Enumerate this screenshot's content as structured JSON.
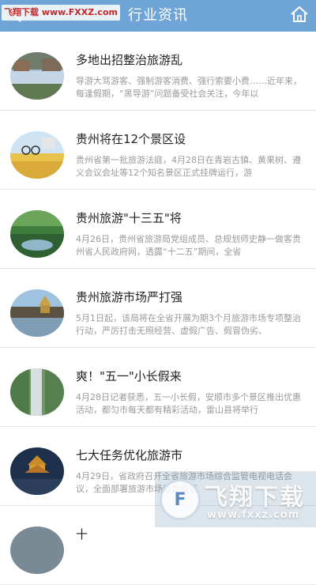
{
  "header": {
    "title": "行业资讯",
    "back_icon": "chevron-left-icon",
    "home_icon": "home-icon",
    "background": "#6fa4d6"
  },
  "watermark": {
    "top_left": "飞翔下载 www.FXXZ.com",
    "brand": "飞翔下载",
    "url": "www.fxxz.com"
  },
  "news": [
    {
      "title": "多地出招整治旅游乱",
      "summary": "导游大骂游客、强制游客消费、强行索要小费……近年来，每逢假期，“黑导游”问题备受社会关注，今年以"
    },
    {
      "title": "贵州将在12个景区设",
      "summary": "贵州省第一批旅游法庭，4月28日在青岩古镇、黄果树、遵义会议会址等12个知名景区正式挂牌运行，游"
    },
    {
      "title": "贵州旅游\"十三五\"将",
      "summary": "4月26日，贵州省旅游局党组成员、总规划师史静一做客贵州省人民政府网，透露“十二五”期间，全省"
    },
    {
      "title": "贵州旅游市场严打强",
      "summary": "5月1日起，该局将在全省开展为期3个月旅游市场专项整治行动，严厉打击无照经营、虚假广告、假冒伪劣、"
    },
    {
      "title": "爽！\"五一\"小长假来",
      "summary": "4月28日记者获悉，五一小长假，安顺市多个景区推出优惠活动，都匀市每天都有精彩活动，雷山县将举行"
    },
    {
      "title": "七大任务优化旅游市",
      "summary": "4月29日，省政府召开全省旅游市场综合监管电视电话会议，全面部署旅游市场综合监管"
    },
    {
      "title": "十",
      "summary": ""
    }
  ]
}
